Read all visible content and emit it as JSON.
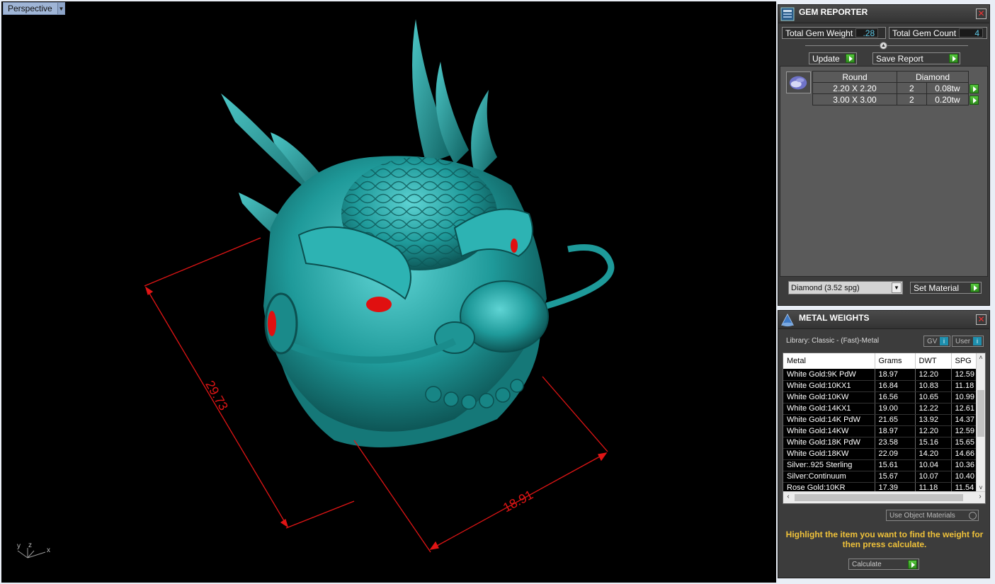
{
  "viewport": {
    "label": "Perspective",
    "axes": {
      "y": "y",
      "z": "z",
      "x": "x"
    },
    "dimensions": [
      "29.73",
      "18.91"
    ]
  },
  "gem_reporter": {
    "title": "GEM REPORTER",
    "total_weight_label": "Total Gem Weight",
    "total_weight_value": ".28",
    "total_count_label": "Total Gem Count",
    "total_count_value": "4",
    "update_label": "Update",
    "save_label": "Save Report",
    "table_header": {
      "shape": "Round",
      "type": "Diamond"
    },
    "rows": [
      {
        "size": "2.20 X 2.20",
        "count": "2",
        "weight": "0.08tw"
      },
      {
        "size": "3.00 X 3.00",
        "count": "2",
        "weight": "0.20tw"
      }
    ],
    "material_select": "Diamond    (3.52 spg)",
    "set_material_label": "Set Material"
  },
  "metal_weights": {
    "title": "METAL WEIGHTS",
    "library": "Library: Classic - (Fast)-Metal",
    "gv_label": "GV",
    "user_label": "User",
    "columns": [
      "Metal",
      "Grams",
      "DWT",
      "SPG"
    ],
    "rows": [
      [
        "White Gold:9K PdW",
        "18.97",
        "12.20",
        "12.59"
      ],
      [
        "White Gold:10KX1",
        "16.84",
        "10.83",
        "11.18"
      ],
      [
        "White Gold:10KW",
        "16.56",
        "10.65",
        "10.99"
      ],
      [
        "White Gold:14KX1",
        "19.00",
        "12.22",
        "12.61"
      ],
      [
        "White Gold:14K PdW",
        "21.65",
        "13.92",
        "14.37"
      ],
      [
        "White Gold:14KW",
        "18.97",
        "12.20",
        "12.59"
      ],
      [
        "White Gold:18K PdW",
        "23.58",
        "15.16",
        "15.65"
      ],
      [
        "White Gold:18KW",
        "22.09",
        "14.20",
        "14.66"
      ],
      [
        "Silver:.925 Sterling",
        "15.61",
        "10.04",
        "10.36"
      ],
      [
        "Silver:Continuum",
        "15.67",
        "10.07",
        "10.40"
      ],
      [
        "Rose Gold:10KR",
        "17.39",
        "11.18",
        "11.54"
      ]
    ],
    "use_object_materials": "Use Object Materials",
    "hint": "Highlight the item you want to find the weight for then press calculate.",
    "calculate_label": "Calculate"
  },
  "colors": {
    "model": "#1f9a9a",
    "dimension": "#e01515",
    "panel": "#3c3c3c",
    "hint": "#f0c23a"
  }
}
